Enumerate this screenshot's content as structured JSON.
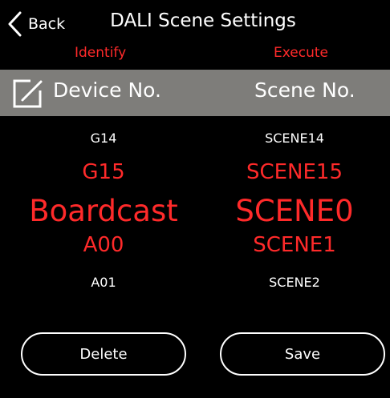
{
  "header": {
    "back_label": "Back",
    "title": "DALI Scene Settings",
    "identify_label": "Identify",
    "execute_label": "Execute"
  },
  "columns": {
    "device_header": "Device No.",
    "scene_header": "Scene No."
  },
  "device_list": [
    "G14",
    "G15",
    "Boardcast",
    "A00",
    "A01"
  ],
  "scene_list": [
    "SCENE14",
    "SCENE15",
    "SCENE0",
    "SCENE1",
    "SCENE2"
  ],
  "selected": {
    "device": "Boardcast",
    "scene": "SCENE0"
  },
  "buttons": {
    "delete_label": "Delete",
    "save_label": "Save"
  },
  "icons": {
    "back": "chevron-left-icon",
    "edit": "edit-icon"
  },
  "colors": {
    "background": "#000000",
    "header_bar": "#7e7d7a",
    "accent_red": "#ff2a2a",
    "text": "#ffffff"
  }
}
